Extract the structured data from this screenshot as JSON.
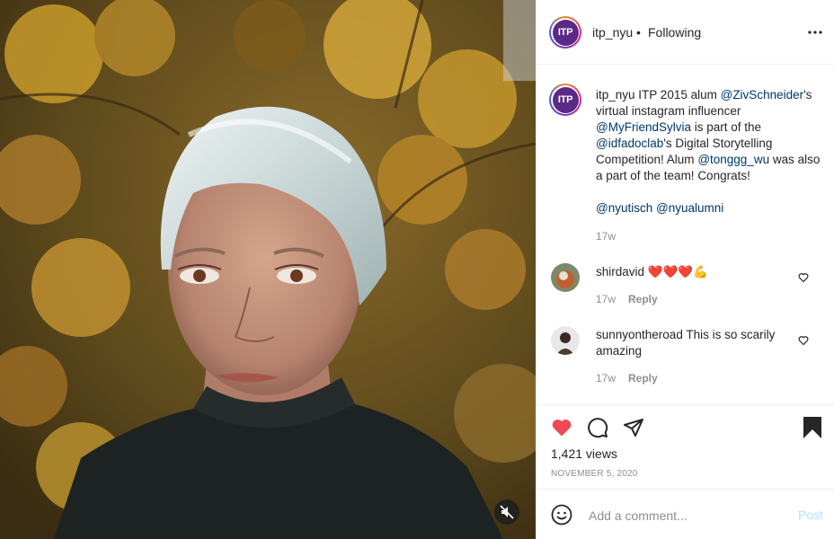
{
  "header": {
    "avatar_text": "ITP",
    "username": "itp_nyu",
    "separator": "•",
    "follow_status": "Following",
    "more_icon": "more-horizontal-icon"
  },
  "caption": {
    "avatar_text": "ITP",
    "username": "itp_nyu",
    "text_1": " ITP 2015 alum ",
    "mention_1": "@ZivSchneider",
    "text_2": "'s virtual instagram influencer ",
    "mention_2": "@MyFriendSylvia",
    "text_3": " is part of the ",
    "mention_3": "@idfadoclab",
    "text_4": "'s Digital Storytelling Competition! Alum ",
    "mention_4": "@tonggg_wu",
    "text_5": " was also a part of the team! Congrats!",
    "tag_1": "@nyutisch",
    "tag_2": "@nyualumni",
    "time": "17w"
  },
  "comments": [
    {
      "username": "shirdavid",
      "text": "",
      "emoji": "❤️❤️❤️💪",
      "time": "17w",
      "reply_label": "Reply"
    },
    {
      "username": "sunnyontheroad",
      "text": "This is so scarily amazing",
      "time": "17w",
      "reply_label": "Reply"
    }
  ],
  "actions": {
    "like_icon": "heart-filled-icon",
    "comment_icon": "comment-icon",
    "share_icon": "paper-plane-icon",
    "save_icon": "bookmark-filled-icon",
    "views": "1,421 views",
    "date": "NOVEMBER 5, 2020"
  },
  "add_comment": {
    "emoji_icon": "smiley-icon",
    "placeholder": "Add a comment...",
    "post_label": "Post"
  },
  "colors": {
    "like_red": "#ed4956",
    "link_blue": "#00376b",
    "post_disabled": "#b2dffc",
    "muted_text": "#8e8e8e"
  }
}
